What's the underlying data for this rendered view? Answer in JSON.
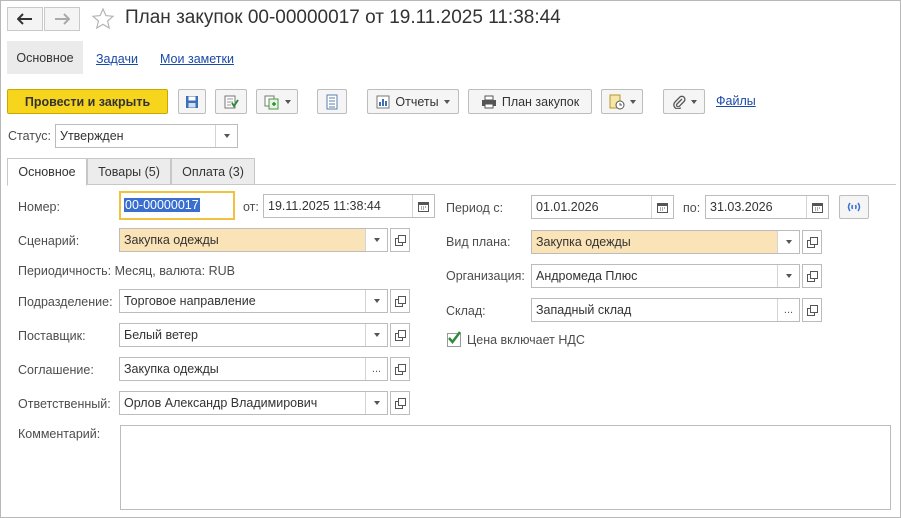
{
  "title": "План закупок 00-00000017 от 19.11.2025 11:38:44",
  "sections": {
    "main": "Основное",
    "tasks": "Задачи",
    "notes": "Мои заметки"
  },
  "toolbar": {
    "post_close": "Провести и закрыть",
    "reports": "Отчеты",
    "purchase_plan": "План закупок",
    "files": "Файлы"
  },
  "status": {
    "label": "Статус:",
    "value": "Утвержден"
  },
  "tabs": [
    "Основное",
    "Товары (5)",
    "Оплата (3)"
  ],
  "form": {
    "number_label": "Номер:",
    "number_value": "00-00000017",
    "from_label": "от:",
    "date_value": "19.11.2025 11:38:44",
    "period_label": "Период с:",
    "period_from": "01.01.2026",
    "period_to_label": "по:",
    "period_to": "31.03.2026",
    "scenario_label": "Сценарий:",
    "scenario_value": "Закупка одежды",
    "plan_type_label": "Вид плана:",
    "plan_type_value": "Закупка одежды",
    "periodicity_text": "Периодичность: Месяц, валюта: RUB",
    "organization_label": "Организация:",
    "organization_value": "Андромеда Плюс",
    "division_label": "Подразделение:",
    "division_value": "Торговое направление",
    "warehouse_label": "Склад:",
    "warehouse_value": "Западный склад",
    "supplier_label": "Поставщик:",
    "supplier_value": "Белый ветер",
    "vat_label": "Цена включает НДС",
    "vat_checked": true,
    "agreement_label": "Соглашение:",
    "agreement_value": "Закупка одежды",
    "responsible_label": "Ответственный:",
    "responsible_value": "Орлов Александр Владимирович",
    "comment_label": "Комментарий:",
    "comment_value": ""
  },
  "colors": {
    "primary_button": "#f7d51d",
    "link": "#1a4aa8",
    "required_field": "#fbe3b8",
    "selection": "#3a6fd0",
    "checkmark": "#2e8b3a"
  }
}
